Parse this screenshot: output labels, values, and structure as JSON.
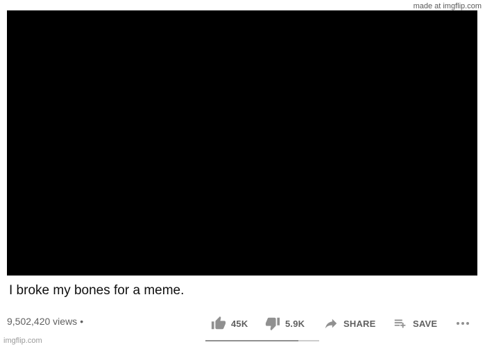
{
  "watermark": {
    "top": "made at imgflip.com",
    "bottom": "imgflip.com"
  },
  "video": {
    "title": "I broke my bones for a meme.",
    "views": "9,502,420 views",
    "separator": "•"
  },
  "actions": {
    "like_count": "45K",
    "dislike_count": "5.9K",
    "share_label": "SHARE",
    "save_label": "SAVE"
  },
  "sentiment": {
    "like_fraction": 0.82
  },
  "colors": {
    "player_background": "#000000",
    "icon_color": "#909090",
    "label_color": "#606060"
  },
  "icons": [
    "thumb-up-icon",
    "thumb-down-icon",
    "share-arrow-icon",
    "playlist-add-icon",
    "more-options-icon"
  ]
}
